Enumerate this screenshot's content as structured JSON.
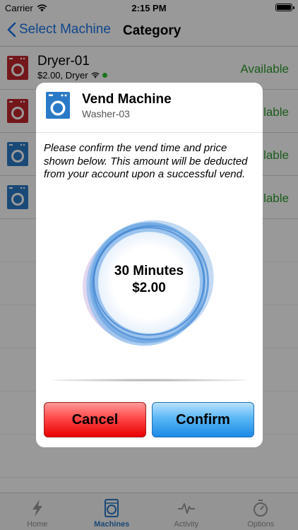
{
  "status_bar": {
    "carrier": "Carrier",
    "time": "2:15 PM"
  },
  "nav": {
    "back_label": "Select Machine",
    "title": "Category"
  },
  "machines": [
    {
      "name": "Dryer-01",
      "subtitle": "$2.00, Dryer",
      "status": "Available",
      "icon_color": "#c1272d"
    },
    {
      "name": "",
      "subtitle": "",
      "status": "ilable",
      "icon_color": "#c1272d"
    },
    {
      "name": "",
      "subtitle": "",
      "status": "ilable",
      "icon_color": "#2a7ac7"
    },
    {
      "name": "",
      "subtitle": "",
      "status": "ilable",
      "icon_color": "#2a7ac7"
    }
  ],
  "modal": {
    "title": "Vend Machine",
    "machine": "Washer-03",
    "message": "Please confirm the vend time and price shown below. This amount will be deducted from your account upon a successful vend.",
    "duration": "30 Minutes",
    "price": "$2.00",
    "cancel_label": "Cancel",
    "confirm_label": "Confirm"
  },
  "tabbar": {
    "tabs": [
      {
        "label": "Home",
        "icon": "lightning-icon",
        "active": false
      },
      {
        "label": "Machines",
        "icon": "washer-icon",
        "active": true
      },
      {
        "label": "Activity",
        "icon": "pulse-icon",
        "active": false
      },
      {
        "label": "Options",
        "icon": "stopwatch-icon",
        "active": false
      }
    ]
  },
  "colors": {
    "accent": "#1a73e8",
    "available": "#2e9a2e",
    "cancel": "#ff3b3b",
    "confirm": "#1b8ae6"
  }
}
